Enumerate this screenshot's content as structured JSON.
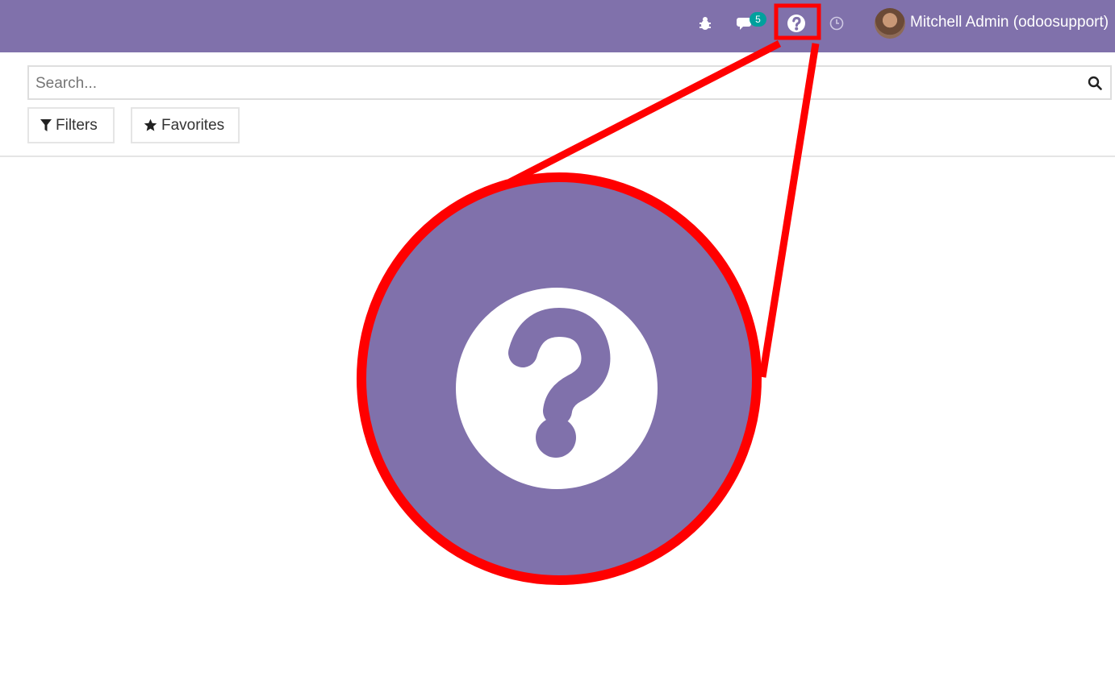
{
  "topbar": {
    "bg_color": "#8071ab",
    "debug_icon": "bug-icon",
    "messages_icon": "chat-icon",
    "messages_count": "5",
    "help_icon": "question-circle-icon",
    "activity_icon": "clock-icon",
    "user_name": "Mitchell Admin (odoosupport)"
  },
  "search": {
    "placeholder": "Search...",
    "icon": "search-icon"
  },
  "filters_label": "Filters",
  "favorites_label": "Favorites",
  "callout": {
    "highlight_color": "#ff0000",
    "zoomed_icon": "question-circle-icon"
  }
}
